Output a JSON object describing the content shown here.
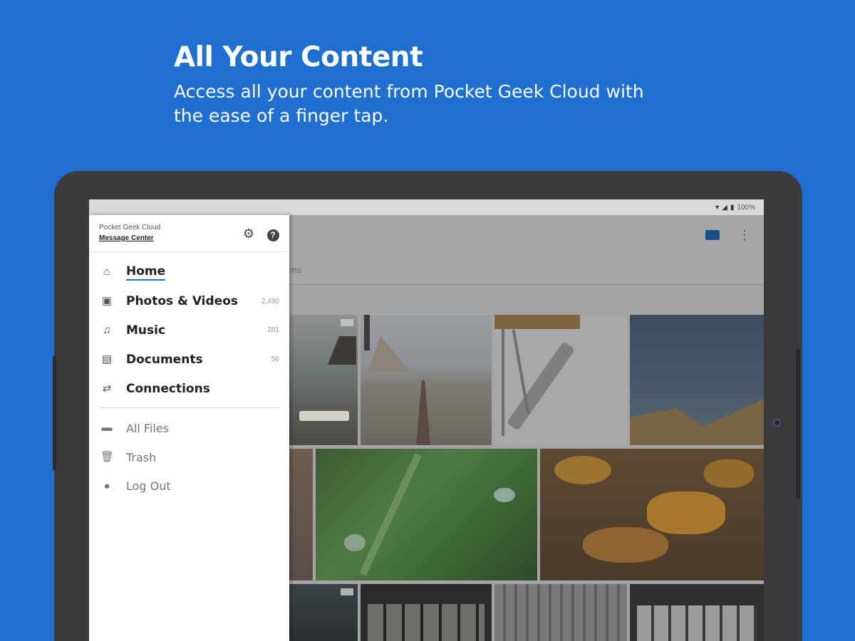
{
  "promo": {
    "headline": "All Your Content",
    "subline": "Access all your content from Pocket Geek Cloud with the ease of a finger tap."
  },
  "status_bar": {
    "battery": "100%"
  },
  "drawer": {
    "brand": "Pocket Geek Cloud",
    "message_center": "Message Center",
    "primary_items": [
      {
        "label": "Home",
        "count": "",
        "icon": "home-icon",
        "active": true
      },
      {
        "label": "Photos & Videos",
        "count": "2,490",
        "icon": "photo-icon"
      },
      {
        "label": "Music",
        "count": "281",
        "icon": "headphones-icon"
      },
      {
        "label": "Documents",
        "count": "56",
        "icon": "document-icon"
      },
      {
        "label": "Connections",
        "count": "",
        "icon": "connections-icon"
      }
    ],
    "secondary_items": [
      {
        "label": "All Files",
        "icon": "folder-icon"
      },
      {
        "label": "Trash",
        "icon": "trash-icon"
      },
      {
        "label": "Log Out",
        "icon": "logout-icon"
      }
    ]
  },
  "background_app": {
    "tab_fragment": "ums"
  },
  "colors": {
    "brand_blue": "#1e6fd0",
    "frame": "#3b3b3d"
  }
}
